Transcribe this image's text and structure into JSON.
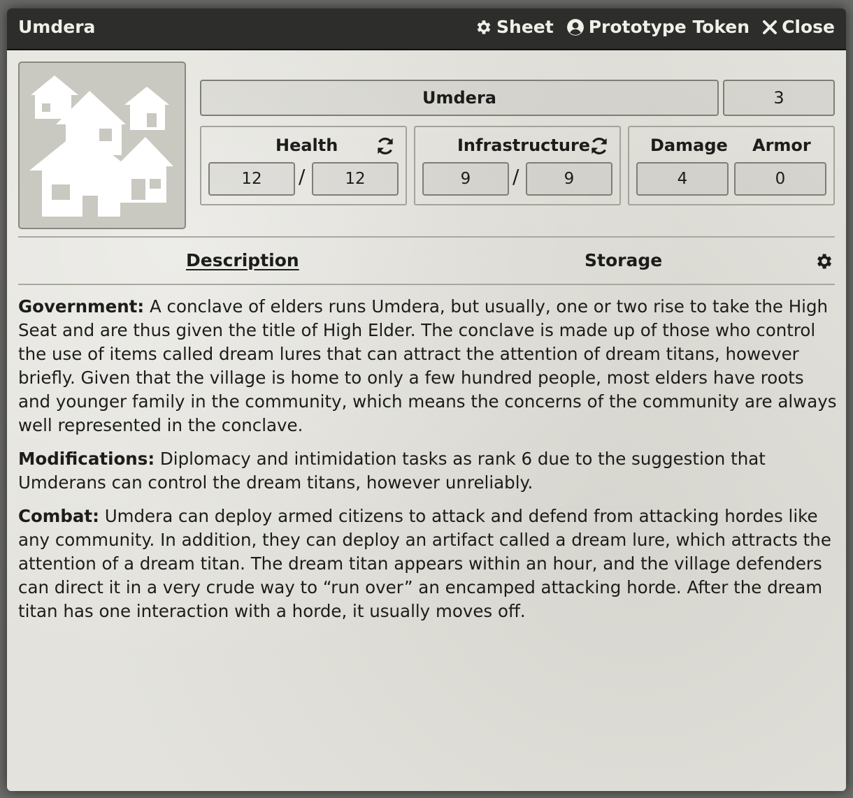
{
  "window": {
    "title": "Umdera",
    "controls": {
      "sheet_label": "Sheet",
      "sheet_icon": "gear-icon",
      "token_label": "Prototype Token",
      "token_icon": "user-circle-icon",
      "close_label": "Close",
      "close_icon": "close-icon"
    }
  },
  "portrait": {
    "icon": "village-houses-icon"
  },
  "header": {
    "name": "Umdera",
    "level": "3"
  },
  "stats": {
    "health": {
      "label": "Health",
      "current": "12",
      "max": "12",
      "separator": "/"
    },
    "infrastructure": {
      "label": "Infrastructure",
      "current": "9",
      "max": "9",
      "separator": "/"
    },
    "damage": {
      "label": "Damage",
      "value": "4"
    },
    "armor": {
      "label": "Armor",
      "value": "0"
    }
  },
  "tabs": [
    {
      "label": "Description",
      "active": true
    },
    {
      "label": "Storage",
      "active": false
    }
  ],
  "description": [
    {
      "heading": "Government:",
      "text": " A conclave of elders runs Umdera, but usually, one or two rise to take the High Seat and are thus given the title of High Elder. The conclave is made up of those who control the use of items called dream lures that can attract the attention of dream titans, however briefly. Given that the village is home to only a few hundred people, most elders have roots and younger family in the community, which means the concerns of the community are always well represented in the conclave."
    },
    {
      "heading": "Modifications:",
      "text": " Diplomacy and intimidation tasks as rank 6 due to the suggestion that Umderans can control the dream titans, however unreliably."
    },
    {
      "heading": "Combat:",
      "text": " Umdera can deploy armed citizens to attack and defend from attacking hordes like any community. In addition, they can deploy an artifact called a dream lure, which attracts the attention of a dream titan. The dream titan appears within an hour, and the village defenders can direct it in a very crude way to “run over” an encamped attacking horde. After the dream titan has one interaction with a horde, it usually moves off."
    }
  ],
  "colors": {
    "titlebar": "#2d2d2b",
    "parchment": "#e3e2dc",
    "text": "#1c1c1a",
    "border": "#7f7e76"
  }
}
